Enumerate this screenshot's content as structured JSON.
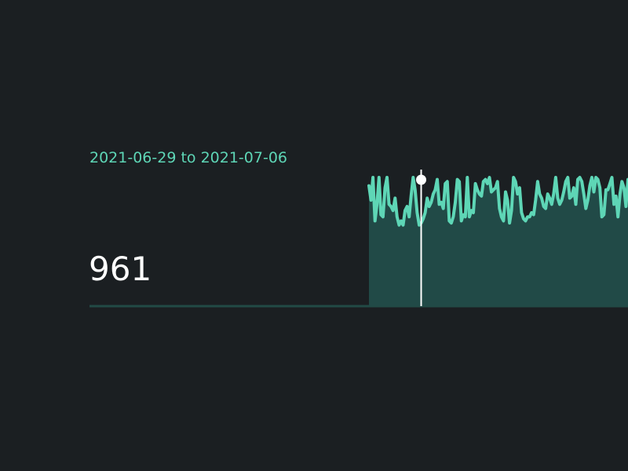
{
  "header": {
    "date_range": "2021-06-29 to 2021-07-06"
  },
  "summary": {
    "value": "961"
  },
  "colors": {
    "background": "#1b1f22",
    "accent": "#5ed6b6",
    "area_fill": "#214a47",
    "baseline": "#224a45",
    "cursor": "#ffffff"
  },
  "chart_data": {
    "type": "area",
    "title": "",
    "xlabel": "",
    "ylabel": "",
    "grid": false,
    "ylim": [
      0,
      100
    ],
    "cursor_index": 26,
    "series": [
      {
        "values": [
          92,
          78,
          100,
          58,
          74,
          100,
          64,
          62,
          90,
          100,
          74,
          72,
          68,
          80,
          62,
          54,
          58,
          54,
          68,
          72,
          62,
          82,
          100,
          88,
          66,
          54,
          56,
          60,
          66,
          80,
          72,
          76,
          84,
          88,
          98,
          74,
          76,
          70,
          94,
          96,
          58,
          56,
          62,
          76,
          98,
          96,
          58,
          64,
          62,
          100,
          62,
          68,
          66,
          94,
          88,
          84,
          82,
          96,
          98,
          94,
          100,
          86,
          88,
          90,
          96,
          70,
          62,
          58,
          86,
          78,
          56,
          68,
          100,
          96,
          84,
          90,
          66,
          60,
          58,
          62,
          62,
          66,
          64,
          78,
          96,
          84,
          80,
          72,
          70,
          84,
          80,
          74,
          84,
          100,
          80,
          74,
          78,
          86,
          96,
          100,
          80,
          82,
          90,
          74,
          98,
          100,
          96,
          84,
          70,
          78,
          92,
          100,
          86,
          100,
          98,
          90,
          62,
          64,
          88,
          88,
          94,
          100,
          74,
          82,
          62,
          84,
          96,
          90,
          72,
          98
        ]
      }
    ]
  }
}
